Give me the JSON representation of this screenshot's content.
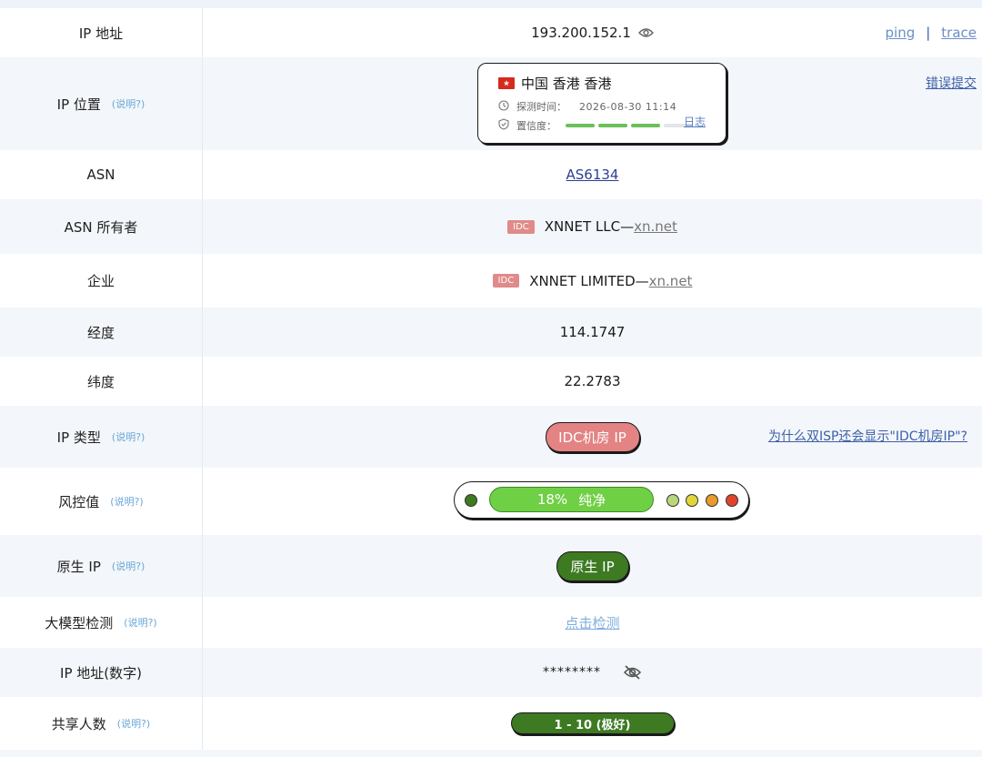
{
  "rows": {
    "ip": {
      "label": "IP 地址",
      "value": "193.200.152.1",
      "ping": "ping",
      "separator": "|",
      "trace": "trace"
    },
    "location": {
      "label": "IP 位置",
      "hint": "(说明?)",
      "report_link": "错误提交",
      "place": "中国 香港 香港",
      "detect_time_label": "探测时间：",
      "detect_time": "2026-08-30 11:14",
      "confidence_label": "置信度：",
      "confidence_level": 3,
      "confidence_max": 4,
      "log_link": "日志"
    },
    "asn": {
      "label": "ASN",
      "value": "AS6134"
    },
    "asn_owner": {
      "label": "ASN 所有者",
      "tag": "IDC",
      "name": "XNNET LLC—",
      "domain": "xn.net"
    },
    "company": {
      "label": "企业",
      "tag": "IDC",
      "name": "XNNET LIMITED—",
      "domain": "xn.net"
    },
    "longitude": {
      "label": "经度",
      "value": "114.1747"
    },
    "latitude": {
      "label": "纬度",
      "value": "22.2783"
    },
    "ip_type": {
      "label": "IP 类型",
      "hint": "(说明?)",
      "value": "IDC机房 IP",
      "side_link": "为什么双ISP还会显示\"IDC机房IP\"?"
    },
    "risk": {
      "label": "风控值",
      "hint": "(说明?)",
      "percent": "18%",
      "text": "纯净",
      "score": 18,
      "dot_colors": [
        "#3d7a22",
        "#b9d77a",
        "#e0d63a",
        "#e99a2c",
        "#e0452b"
      ]
    },
    "native": {
      "label": "原生 IP",
      "hint": "(说明?)",
      "value": "原生 IP"
    },
    "llm": {
      "label": "大模型检测",
      "hint": "(说明?)",
      "value": "点击检测"
    },
    "ip_numeric": {
      "label": "IP 地址(数字)",
      "value": "********"
    },
    "shared": {
      "label": "共享人数",
      "hint": "(说明?)",
      "value": "1 - 10 (极好)"
    }
  },
  "colors": {
    "accent_link": "#3b5fa8",
    "idc": "#e38383",
    "native_green": "#3d7a22",
    "risk_green": "#6fcf45"
  },
  "icons": [
    "eye-icon",
    "eye-off-icon",
    "clock-icon",
    "shield-check-icon",
    "hk-flag-icon"
  ]
}
